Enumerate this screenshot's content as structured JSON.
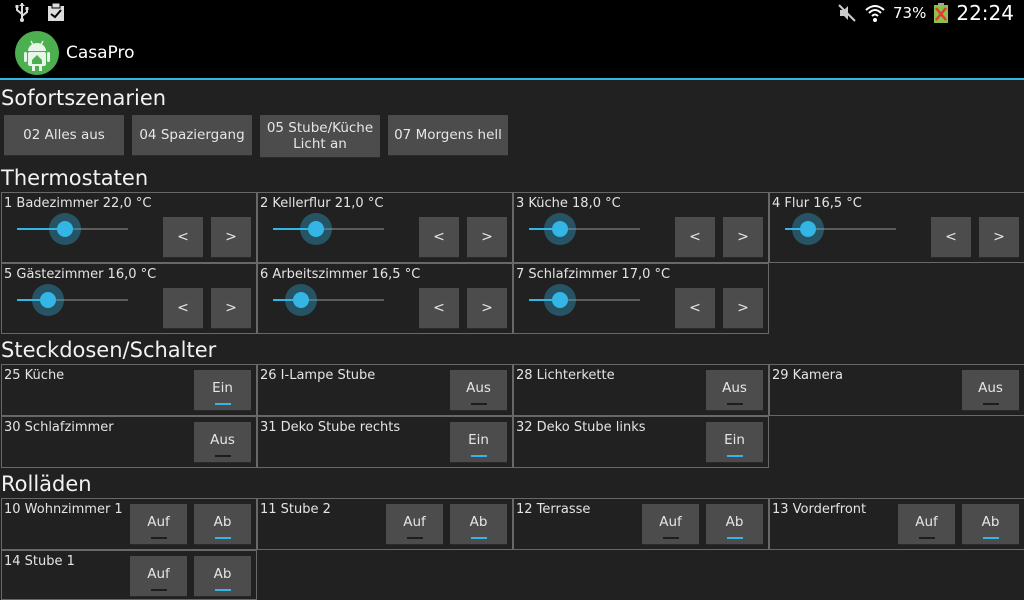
{
  "statusbar": {
    "left_icons": [
      "usb-icon",
      "clipboard-check-icon"
    ],
    "right_icons": [
      "muted-icon",
      "wifi-icon",
      "battery-icon"
    ],
    "battery_pct": "73%",
    "time": "22:24"
  },
  "app": {
    "title": "CasaPro",
    "icon": "android-home-icon"
  },
  "colors": {
    "accent": "#33b5e5",
    "button": "#4c4c4c",
    "background": "#212121"
  },
  "sections": {
    "scenarios": "Sofortszenarien",
    "thermostats": "Thermostaten",
    "sockets": "Steckdosen/Schalter",
    "shutters": "Rolläden"
  },
  "scenarios": [
    "02 Alles aus",
    "04 Spaziergang",
    "05 Stube/Küche Licht an",
    "07 Morgens hell"
  ],
  "thermostats": [
    {
      "label": "1 Badezimmer 22,0 °C",
      "level": 0.43
    },
    {
      "label": "2 Kellerflur 21,0 °C",
      "level": 0.39
    },
    {
      "label": "3 Küche 18,0 °C",
      "level": 0.28
    },
    {
      "label": "4 Flur 16,5 °C",
      "level": 0.21
    },
    {
      "label": "5 Gästezimmer 16,0 °C",
      "level": 0.28
    },
    {
      "label": "6 Arbeitszimmer 16,5 °C",
      "level": 0.25
    },
    {
      "label": "7 Schlafzimmer 17,0 °C",
      "level": 0.28
    }
  ],
  "thermostat_buttons": {
    "decrease": "<",
    "increase": ">"
  },
  "sockets": [
    {
      "label": "25 Küche",
      "state": "Ein",
      "on": true
    },
    {
      "label": "26 I-Lampe Stube",
      "state": "Aus",
      "on": false
    },
    {
      "label": "28 Lichterkette",
      "state": "Aus",
      "on": false
    },
    {
      "label": "29 Kamera",
      "state": "Aus",
      "on": false
    },
    {
      "label": "30 Schlafzimmer",
      "state": "Aus",
      "on": false
    },
    {
      "label": "31 Deko Stube rechts",
      "state": "Ein",
      "on": true
    },
    {
      "label": "32 Deko Stube links",
      "state": "Ein",
      "on": true
    }
  ],
  "shutter_buttons": {
    "up": "Auf",
    "down": "Ab"
  },
  "shutters": [
    {
      "label": "10 Wohnzimmer 1",
      "down_active": true
    },
    {
      "label": "11 Stube 2",
      "down_active": true
    },
    {
      "label": "12 Terrasse",
      "down_active": true
    },
    {
      "label": "13 Vorderfront",
      "down_active": true
    },
    {
      "label": "14 Stube 1",
      "down_active": true
    }
  ]
}
